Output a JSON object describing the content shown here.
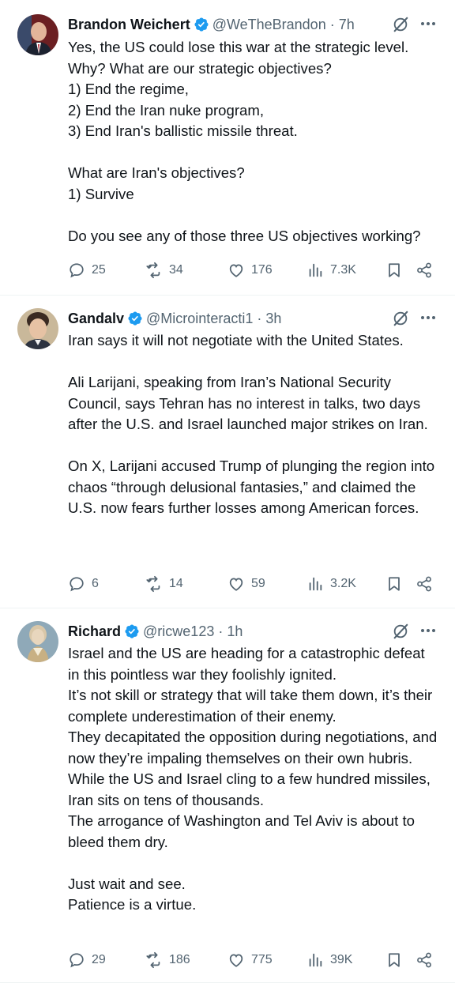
{
  "tweets": [
    {
      "name": "Brandon Weichert",
      "handle": "@WeTheBrandon",
      "time": "7h",
      "text": "Yes, the US could lose this war at the strategic level. Why? What are our strategic objectives?\n1) End the regime,\n2) End the Iran nuke program,\n3) End Iran's ballistic missile threat.\n\nWhat are Iran's objectives?\n1) Survive\n\nDo you see any of those three US objectives working?",
      "replies": "25",
      "reposts": "34",
      "likes": "176",
      "views": "7.3K"
    },
    {
      "name": "Gandalv",
      "handle": "@Microinteracti1",
      "time": "3h",
      "text": "Iran says it will not negotiate with the United States.\n\nAli Larijani, speaking from Iran’s National Security Council, says Tehran has no interest in talks, two days after the U.S. and Israel launched major strikes on Iran.\n\nOn X, Larijani accused Trump of plunging the region into chaos “through delusional fantasies,” and claimed the U.S. now fears further losses among American forces.",
      "replies": "6",
      "reposts": "14",
      "likes": "59",
      "views": "3.2K"
    },
    {
      "name": "Richard",
      "handle": "@ricwe123",
      "time": "1h",
      "text": "Israel and the US are heading for a catastrophic defeat in this pointless war they foolishly ignited.\nIt’s not skill or strategy that will take them down, it’s their complete underestimation of their enemy.\nThey decapitated the opposition during negotiations, and now they’re impaling themselves on their own hubris.\nWhile the US and Israel cling to a few hundred missiles, Iran sits on tens of thousands.\nThe arrogance of Washington and Tel Aviv is about to bleed them dry.\n\nJust wait and see.\nPatience is a virtue.",
      "replies": "29",
      "reposts": "186",
      "likes": "775",
      "views": "39K"
    }
  ],
  "icons": {
    "verified": "verified-badge-icon",
    "grok": "grok-icon",
    "more": "more-icon",
    "reply": "reply-icon",
    "repost": "repost-icon",
    "like": "like-icon",
    "views": "views-icon",
    "bookmark": "bookmark-icon",
    "share": "share-icon"
  },
  "colors": {
    "verified": "#1d9bf0",
    "text": "#0f1419",
    "muted": "#536471",
    "divider": "#eff3f4"
  }
}
